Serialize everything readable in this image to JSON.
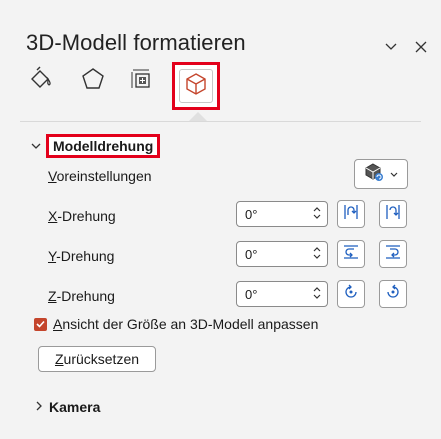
{
  "pane": {
    "title": "3D-Modell formatieren"
  },
  "section": {
    "label": "Modelldrehung"
  },
  "presets": {
    "label_first": "V",
    "label_rest": "oreinstellungen"
  },
  "x_rotation": {
    "label_first": "X",
    "label_rest": "-Drehung",
    "value": "0°"
  },
  "y_rotation": {
    "label_first": "Y",
    "label_rest": "-Drehung",
    "value": "0°"
  },
  "z_rotation": {
    "label_first": "Z",
    "label_rest": "-Drehung",
    "value": "0°"
  },
  "fit_checkbox": {
    "label_first": "A",
    "label_rest": "nsicht der Größe an 3D-Modell anpassen",
    "checked": true
  },
  "reset_button": {
    "label_first": "Z",
    "label_rest": "urücksetzen"
  },
  "camera_section": {
    "label": "Kamera"
  },
  "colors": {
    "highlight": "#e3001b",
    "accent": "#c4452c",
    "background": "#f3f3f3"
  },
  "icons": [
    "fill-line-icon",
    "effects-pentagon-icon",
    "size-properties-icon",
    "3d-model-icon",
    "chevron-down-icon",
    "close-icon",
    "rotate-icon"
  ]
}
